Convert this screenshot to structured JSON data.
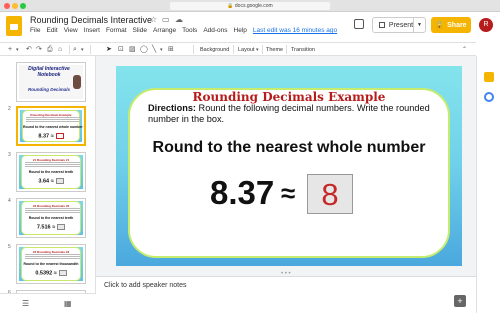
{
  "browser": {
    "url": "docs.google.com"
  },
  "header": {
    "title": "Rounding Decimals Interactive",
    "menu": [
      "File",
      "Edit",
      "View",
      "Insert",
      "Format",
      "Slide",
      "Arrange",
      "Tools",
      "Add-ons",
      "Help"
    ],
    "last_edit": "Last edit was 16 minutes ago",
    "present_label": "Present",
    "share_label": "Share",
    "avatar_initial": "R"
  },
  "toolbar": {
    "background": "Background",
    "layout": "Layout",
    "theme": "Theme",
    "transition": "Transition"
  },
  "filmstrip": {
    "slide1": {
      "number": "1",
      "title": "Digital Interactive Notebook",
      "subtitle": "Rounding Decimals"
    },
    "thumbs": [
      {
        "number": "2",
        "title": "Rounding Decimals Example",
        "heading": "Round to the nearest whole number",
        "equation": "8.37 ≈"
      },
      {
        "number": "3",
        "title": "#1 Rounding Decimals #1",
        "heading": "Round to the nearest tenth",
        "equation": "3.64 ≈"
      },
      {
        "number": "4",
        "title": "#2 Rounding Decimals #2",
        "heading": "Round to the nearest tenth",
        "equation": "7.516 ≈"
      },
      {
        "number": "5",
        "title": "#3 Rounding Decimals #3",
        "heading": "Round to the nearest thousandth",
        "equation": "0.5392 ≈"
      },
      {
        "number": "6",
        "title": "#4 Rounding Decimals #4",
        "heading": "",
        "equation": ""
      }
    ]
  },
  "slide": {
    "title": "Rounding Decimals Example",
    "directions_label": "Directions:",
    "directions_text": " Round the following decimal numbers. Write the rounded number in the box.",
    "heading": "Round to the nearest whole number",
    "number": "8.37",
    "approx": "≈",
    "answer": "8"
  },
  "notes": {
    "placeholder": "Click to add speaker notes"
  },
  "colors": {
    "accent": "#f4b400",
    "title_red": "#b71c1c",
    "link_blue": "#1a73e8"
  }
}
